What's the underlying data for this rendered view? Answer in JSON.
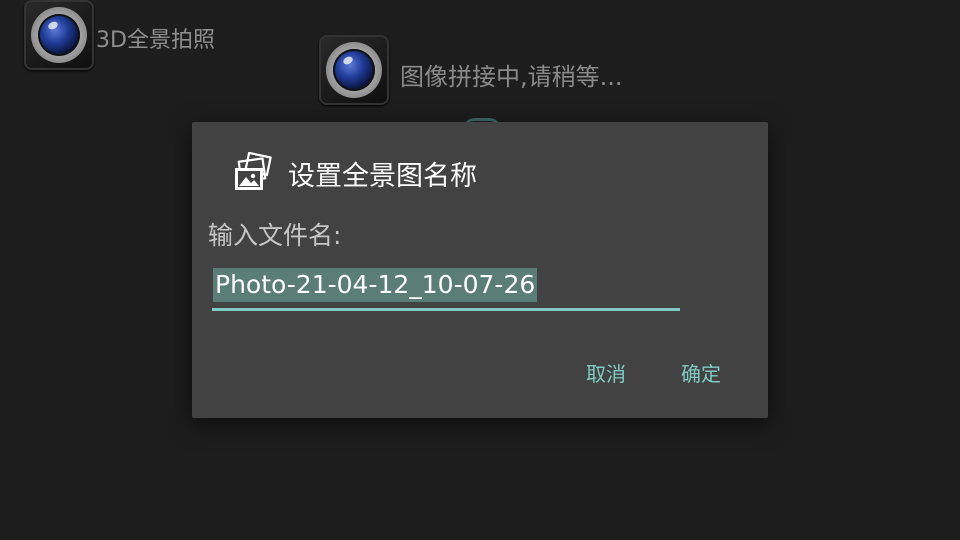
{
  "background": {
    "app_title": "3D全景拍照",
    "status_text": "图像拼接中,请稍等..."
  },
  "dialog": {
    "title": "设置全景图名称",
    "label": "输入文件名:",
    "input_value": "Photo-21-04-12_10-07-26",
    "cancel_label": "取消",
    "confirm_label": "确定"
  },
  "colors": {
    "dialog_bg": "#424242",
    "accent": "#7fcbc4",
    "selection": "#5b7d78"
  },
  "icons": {
    "app": "camera-lens-icon",
    "dialog": "gallery-images-icon"
  }
}
